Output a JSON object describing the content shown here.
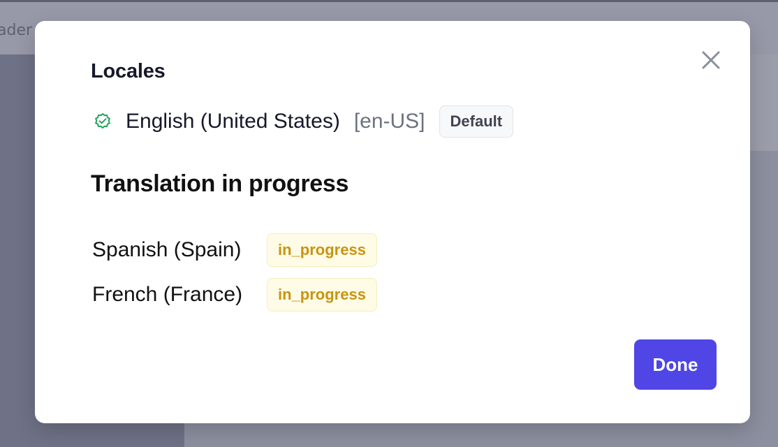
{
  "background": {
    "topbar_text": "ader"
  },
  "modal": {
    "title": "Locales",
    "default_locale": {
      "name": "English (United States)",
      "code": "[en-US]",
      "badge": "Default",
      "status_icon": "check-circle-icon"
    },
    "section_title": "Translation in progress",
    "in_progress": [
      {
        "name": "Spanish (Spain)",
        "status": "in_progress"
      },
      {
        "name": "French (France)",
        "status": "in_progress"
      }
    ],
    "done_label": "Done",
    "close_icon": "close-icon"
  },
  "colors": {
    "accent": "#4f46e5",
    "success": "#22a35a",
    "warning_text": "#c99411",
    "warning_bg": "#fefbe6"
  }
}
